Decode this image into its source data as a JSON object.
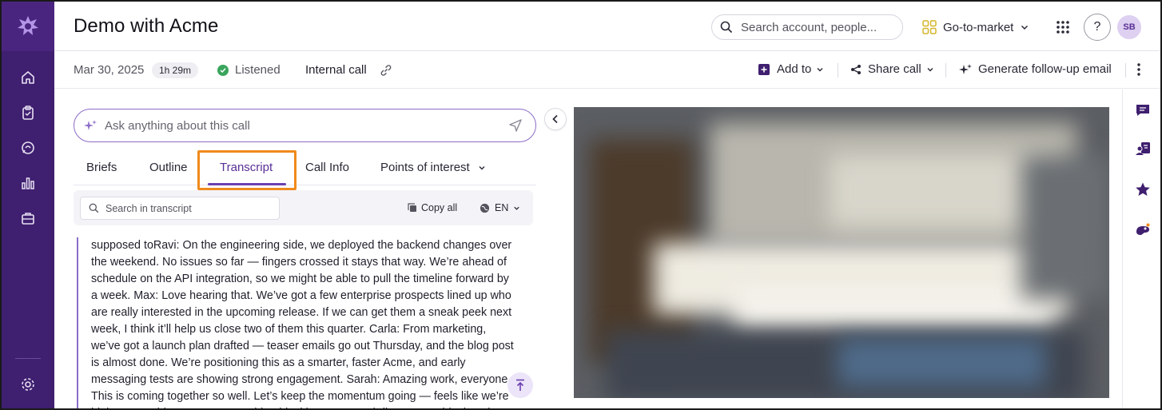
{
  "header": {
    "title": "Demo with Acme",
    "search_placeholder": "Search account, people...",
    "workspace_label": "Go-to-market",
    "help_label": "?",
    "avatar_initials": "SB"
  },
  "call_meta": {
    "date": "Mar 30, 2025",
    "duration": "1h 29m",
    "status": "Listened",
    "call_type": "Internal call"
  },
  "actions": {
    "add_to": "Add to",
    "share_call": "Share call",
    "generate_email": "Generate follow-up email"
  },
  "ask": {
    "placeholder": "Ask anything about this call"
  },
  "tabs": [
    {
      "label": "Briefs"
    },
    {
      "label": "Outline"
    },
    {
      "label": "Transcript"
    },
    {
      "label": "Call Info"
    },
    {
      "label": "Points of interest"
    }
  ],
  "transcript_toolbar": {
    "search_placeholder": "Search in transcript",
    "copy_all": "Copy all",
    "language": "EN"
  },
  "transcript": {
    "text": "supposed toRavi: On the engineering side, we deployed the backend changes over the weekend. No issues so far — fingers crossed it stays that way. We’re ahead of schedule on the API integration, so we might be able to pull the timeline forward by a week. Max: Love hearing that. We’ve got a few enterprise prospects lined up who are really interested in the upcoming release. If we can get them a sneak peek next week, I think it’ll help us close two of them this quarter. Carla: From marketing, we’ve got a launch plan drafted — teaser emails go out Thursday, and the blog post is almost done. We’re positioning this as a smarter, faster Acme, and early messaging tests are showing strong engagement. Sarah: Amazing work, everyone. This is coming together so well. Let’s keep the momentum going — feels like we’re hitting our stride as a team. Anything blocking anyone? (All agree, no blockers.)"
  },
  "colors": {
    "sidebar": "#3f1f6f",
    "accent": "#6b3fb0",
    "highlight": "#f08a1c",
    "listened": "#3aa55d"
  }
}
